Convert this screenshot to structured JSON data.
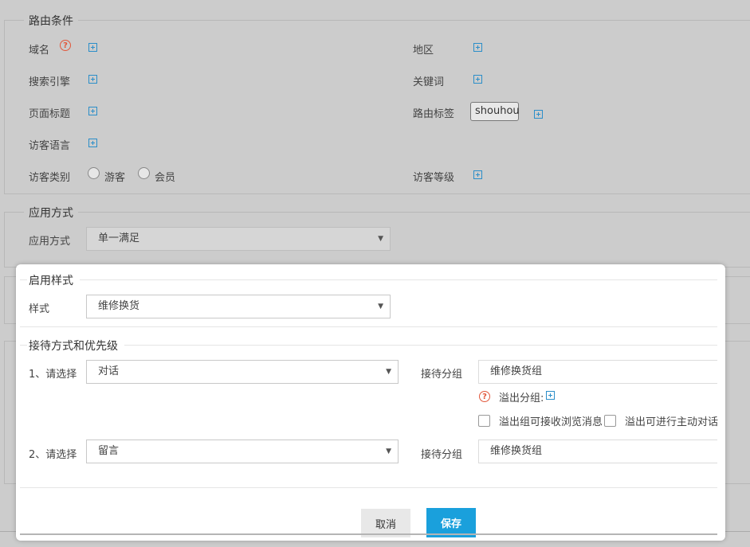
{
  "routing": {
    "legend": "路由条件",
    "domain_label": "域名",
    "help_glyph": "?",
    "region_label": "地区",
    "search_engine_label": "搜索引擎",
    "keyword_label": "关键词",
    "page_title_label": "页面标题",
    "route_tag_label": "路由标签",
    "route_tag_value": "shouhou",
    "visitor_lang_label": "访客语言",
    "visitor_type_label": "访客类别",
    "visitor_type_options": [
      "游客",
      "会员"
    ],
    "visitor_level_label": "访客等级"
  },
  "apply": {
    "legend": "应用方式",
    "label": "应用方式",
    "value": "单一满足"
  },
  "modal": {
    "style_legend": "启用样式",
    "style_label": "样式",
    "style_value": "维修换货",
    "reception_legend": "接待方式和优先级",
    "row1": {
      "label": "1、请选择",
      "value": "对话",
      "group_label": "接待分组",
      "group_value": "维修换货组",
      "overflow_label": "溢出分组:",
      "check1": "溢出组可接收浏览消息",
      "check2": "溢出可进行主动对话"
    },
    "row2": {
      "label": "2、请选择",
      "value": "留言",
      "group_label": "接待分组",
      "group_value": "维修换货组"
    },
    "cancel_label": "取消",
    "save_label": "保存"
  }
}
